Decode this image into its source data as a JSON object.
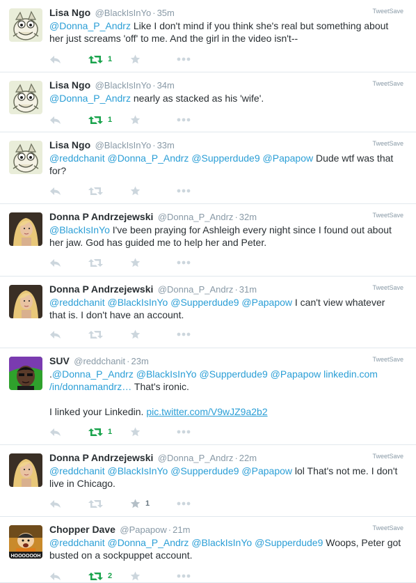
{
  "colors": {
    "mention": "#2a9ed6",
    "muted": "#8899a6",
    "icon": "#ccd6dd",
    "icon_dark": "#b4bfc7",
    "retweeted": "#19a34c",
    "divider": "#e1e8ed"
  },
  "tweets": [
    {
      "avatar": "monster-avatar",
      "name": "Lisa Ngo",
      "handle": "@BlackIsInYo",
      "time": "35m",
      "source": "TweetSave",
      "segments": [
        {
          "type": "mention",
          "text": "@Donna_P_Andrz"
        },
        {
          "type": "text",
          "text": " Like I don't mind if you think she's real but something about her just screams 'off' to me. And the girl in the video isn't--"
        }
      ],
      "retweets": "1",
      "likes": ""
    },
    {
      "avatar": "monster-avatar",
      "name": "Lisa Ngo",
      "handle": "@BlackIsInYo",
      "time": "34m",
      "source": "TweetSave",
      "segments": [
        {
          "type": "mention",
          "text": "@Donna_P_Andrz"
        },
        {
          "type": "text",
          "text": " nearly as stacked as his 'wife'."
        }
      ],
      "retweets": "1",
      "likes": ""
    },
    {
      "avatar": "monster-avatar",
      "name": "Lisa Ngo",
      "handle": "@BlackIsInYo",
      "time": "33m",
      "source": "TweetSave",
      "segments": [
        {
          "type": "mention",
          "text": "@reddchanit"
        },
        {
          "type": "text",
          "text": " "
        },
        {
          "type": "mention",
          "text": "@Donna_P_Andrz"
        },
        {
          "type": "text",
          "text": " "
        },
        {
          "type": "mention",
          "text": "@Supperdude9"
        },
        {
          "type": "text",
          "text": " "
        },
        {
          "type": "mention",
          "text": "@Papapow"
        },
        {
          "type": "text",
          "text": " Dude wtf was that for?"
        }
      ],
      "retweets": "",
      "likes": ""
    },
    {
      "avatar": "woman-avatar",
      "name": "Donna P Andrzejewski",
      "handle": "@Donna_P_Andrz",
      "time": "32m",
      "source": "TweetSave",
      "segments": [
        {
          "type": "mention",
          "text": "@BlackIsInYo"
        },
        {
          "type": "text",
          "text": " I've been praying for Ashleigh every night since I found out about her jaw. God has guided me to help her and Peter."
        }
      ],
      "retweets": "",
      "likes": ""
    },
    {
      "avatar": "woman-avatar",
      "name": "Donna P Andrzejewski",
      "handle": "@Donna_P_Andrz",
      "time": "31m",
      "source": "TweetSave",
      "segments": [
        {
          "type": "mention",
          "text": "@reddchanit"
        },
        {
          "type": "text",
          "text": " "
        },
        {
          "type": "mention",
          "text": "@BlackIsInYo"
        },
        {
          "type": "text",
          "text": " "
        },
        {
          "type": "mention",
          "text": "@Supperdude9"
        },
        {
          "type": "text",
          "text": " "
        },
        {
          "type": "mention",
          "text": "@Papapow"
        },
        {
          "type": "text",
          "text": " I can't view whatever that is. I don't have an account."
        }
      ],
      "retweets": "",
      "likes": ""
    },
    {
      "avatar": "suv-avatar",
      "name": "SUV",
      "handle": "@reddchanit",
      "time": "23m",
      "source": "TweetSave",
      "segments": [
        {
          "type": "text",
          "text": "."
        },
        {
          "type": "mention",
          "text": "@Donna_P_Andrz"
        },
        {
          "type": "text",
          "text": " "
        },
        {
          "type": "mention",
          "text": "@BlackIsInYo"
        },
        {
          "type": "text",
          "text": " "
        },
        {
          "type": "mention",
          "text": "@Supperdude9"
        },
        {
          "type": "text",
          "text": " "
        },
        {
          "type": "mention",
          "text": "@Papapow"
        },
        {
          "type": "text",
          "text": " "
        },
        {
          "type": "link",
          "text": "linkedin.com /in/donnamandrz…"
        },
        {
          "type": "text",
          "text": " That's ironic."
        },
        {
          "type": "break"
        },
        {
          "type": "text",
          "text": "I linked your Linkedin. "
        },
        {
          "type": "ulink",
          "text": "pic.twitter.com/V9wJZ9a2b2"
        }
      ],
      "retweets": "1",
      "likes": ""
    },
    {
      "avatar": "woman-avatar",
      "name": "Donna P Andrzejewski",
      "handle": "@Donna_P_Andrz",
      "time": "22m",
      "source": "TweetSave",
      "segments": [
        {
          "type": "mention",
          "text": "@reddchanit"
        },
        {
          "type": "text",
          "text": " "
        },
        {
          "type": "mention",
          "text": "@BlackIsInYo"
        },
        {
          "type": "text",
          "text": " "
        },
        {
          "type": "mention",
          "text": "@Supperdude9"
        },
        {
          "type": "text",
          "text": " "
        },
        {
          "type": "mention",
          "text": "@Papapow"
        },
        {
          "type": "text",
          "text": " lol That's not me. I don't live in Chicago."
        }
      ],
      "retweets": "",
      "likes": "1"
    },
    {
      "avatar": "cartoon-avatar",
      "avatar_caption": "HOOOOOOH",
      "name": "Chopper Dave",
      "handle": "@Papapow",
      "time": "21m",
      "source": "TweetSave",
      "segments": [
        {
          "type": "mention",
          "text": "@reddchanit"
        },
        {
          "type": "text",
          "text": " "
        },
        {
          "type": "mention",
          "text": "@Donna_P_Andrz"
        },
        {
          "type": "text",
          "text": " "
        },
        {
          "type": "mention",
          "text": "@BlackIsInYo"
        },
        {
          "type": "text",
          "text": " "
        },
        {
          "type": "mention",
          "text": "@Supperdude9"
        },
        {
          "type": "text",
          "text": " Woops, Peter got busted on a sockpuppet account."
        }
      ],
      "retweets": "2",
      "likes": ""
    }
  ]
}
